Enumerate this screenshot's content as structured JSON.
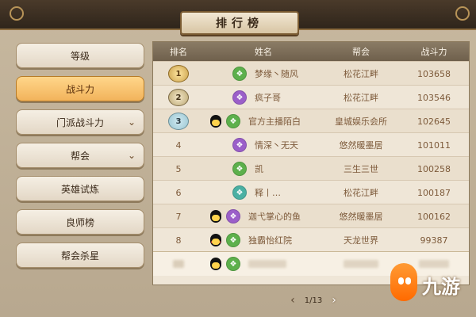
{
  "title": "排行榜",
  "sidebar": {
    "items": [
      {
        "label": "等级",
        "active": false,
        "chevron": false
      },
      {
        "label": "战斗力",
        "active": true,
        "chevron": false
      },
      {
        "label": "门派战斗力",
        "active": false,
        "chevron": true
      },
      {
        "label": "帮会",
        "active": false,
        "chevron": true
      },
      {
        "label": "英雄试炼",
        "active": false,
        "chevron": false
      },
      {
        "label": "良师榜",
        "active": false,
        "chevron": false
      },
      {
        "label": "帮会杀星",
        "active": false,
        "chevron": false
      }
    ]
  },
  "table": {
    "headers": [
      "排名",
      "姓名",
      "帮会",
      "战斗力"
    ],
    "rows": [
      {
        "rank": "1",
        "rank_badge": "gold",
        "sect_icon": "green",
        "qq_icon": "",
        "name": "梦缘丶随风",
        "guild": "松花江畔",
        "power": "103658"
      },
      {
        "rank": "2",
        "rank_badge": "silver",
        "sect_icon": "purple",
        "qq_icon": "",
        "name": "疯子哥",
        "guild": "松花江畔",
        "power": "103546"
      },
      {
        "rank": "3",
        "rank_badge": "bronze",
        "sect_icon": "green",
        "qq_icon": "yellow",
        "name": "官方主播陌白",
        "guild": "皇城娱乐会所",
        "power": "102645"
      },
      {
        "rank": "4",
        "rank_badge": "",
        "sect_icon": "purple",
        "qq_icon": "",
        "name": "情深丶无天",
        "guild": "悠然暖墨居",
        "power": "101011"
      },
      {
        "rank": "5",
        "rank_badge": "",
        "sect_icon": "green",
        "qq_icon": "",
        "name": "凯",
        "guild": "三生三世",
        "power": "100258"
      },
      {
        "rank": "6",
        "rank_badge": "",
        "sect_icon": "teal",
        "qq_icon": "",
        "name": "释丨…",
        "guild": "松花江畔",
        "power": "100187"
      },
      {
        "rank": "7",
        "rank_badge": "",
        "sect_icon": "purple",
        "qq_icon": "yellow",
        "name": "迦弋掌心的鱼",
        "guild": "悠然暖墨居",
        "power": "100162"
      },
      {
        "rank": "8",
        "rank_badge": "",
        "sect_icon": "green",
        "qq_icon": "red",
        "name": "独霸怡红院",
        "guild": "天龙世界",
        "power": "99387"
      },
      {
        "rank": "",
        "rank_badge": "",
        "sect_icon": "green",
        "qq_icon": "yellow",
        "name": "",
        "guild": "",
        "power": "",
        "highlight": true
      }
    ]
  },
  "pager": {
    "prev": "‹",
    "text": "1/13",
    "next": "›"
  },
  "watermark": {
    "text": "九游"
  },
  "colors": {
    "accent": "#f2b35b",
    "header": "#6f604c",
    "text": "#7d5a3a"
  }
}
